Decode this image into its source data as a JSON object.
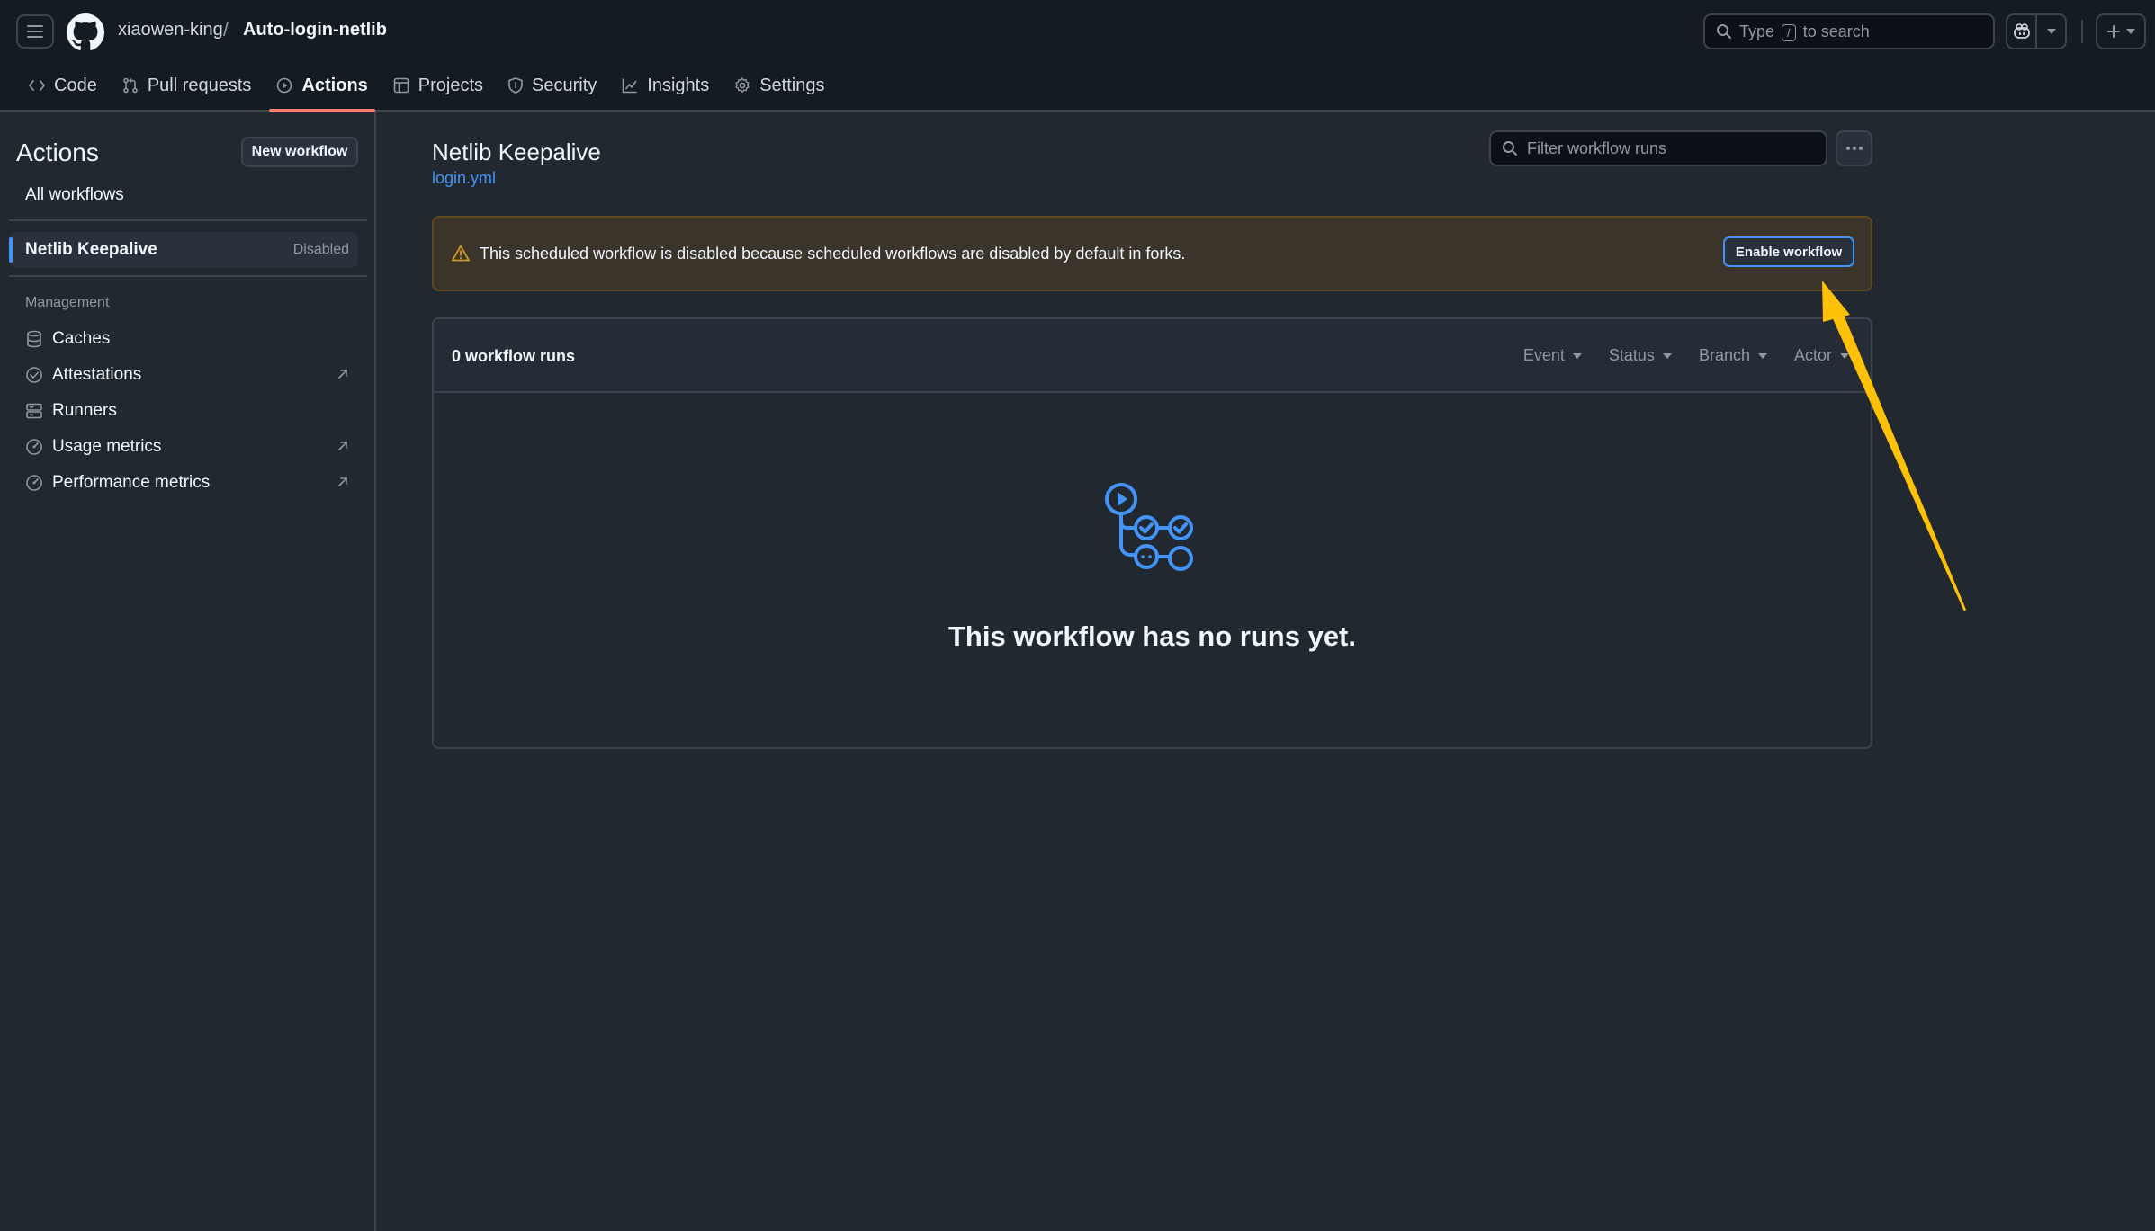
{
  "header": {
    "owner": "xiaowen-king",
    "separator": "/",
    "repo": "Auto-login-netlib",
    "search_prefix": "Type",
    "search_key": "/",
    "search_suffix": "to search"
  },
  "repo_nav": [
    {
      "label": "Code",
      "icon": "code-icon"
    },
    {
      "label": "Pull requests",
      "icon": "git-pull-request-icon"
    },
    {
      "label": "Actions",
      "icon": "play-icon",
      "active": true
    },
    {
      "label": "Projects",
      "icon": "table-icon"
    },
    {
      "label": "Security",
      "icon": "shield-icon"
    },
    {
      "label": "Insights",
      "icon": "graph-icon"
    },
    {
      "label": "Settings",
      "icon": "gear-icon"
    }
  ],
  "sidebar": {
    "title": "Actions",
    "new_workflow": "New workflow",
    "all_workflows": "All workflows",
    "selected_workflow": {
      "name": "Netlib Keepalive",
      "badge": "Disabled"
    },
    "section_label": "Management",
    "items": [
      {
        "label": "Caches",
        "icon": "database-icon",
        "external": false
      },
      {
        "label": "Attestations",
        "icon": "check-circle-icon",
        "external": true
      },
      {
        "label": "Runners",
        "icon": "server-icon",
        "external": false
      },
      {
        "label": "Usage metrics",
        "icon": "meter-icon",
        "external": true
      },
      {
        "label": "Performance metrics",
        "icon": "meter-icon",
        "external": true
      }
    ]
  },
  "workflow": {
    "title": "Netlib Keepalive",
    "file": "login.yml",
    "filter_placeholder": "Filter workflow runs"
  },
  "flash": {
    "message": "This scheduled workflow is disabled because scheduled workflows are disabled by default in forks.",
    "button": "Enable workflow"
  },
  "runs": {
    "count_label": "0 workflow runs",
    "filters": [
      "Event",
      "Status",
      "Branch",
      "Actor"
    ],
    "empty_message": "This workflow has no runs yet."
  },
  "colors": {
    "accent_blue": "#4493f8",
    "warning_yellow": "#d29922",
    "annotation_arrow": "#ffc107",
    "active_tab_underline": "#f78166"
  }
}
